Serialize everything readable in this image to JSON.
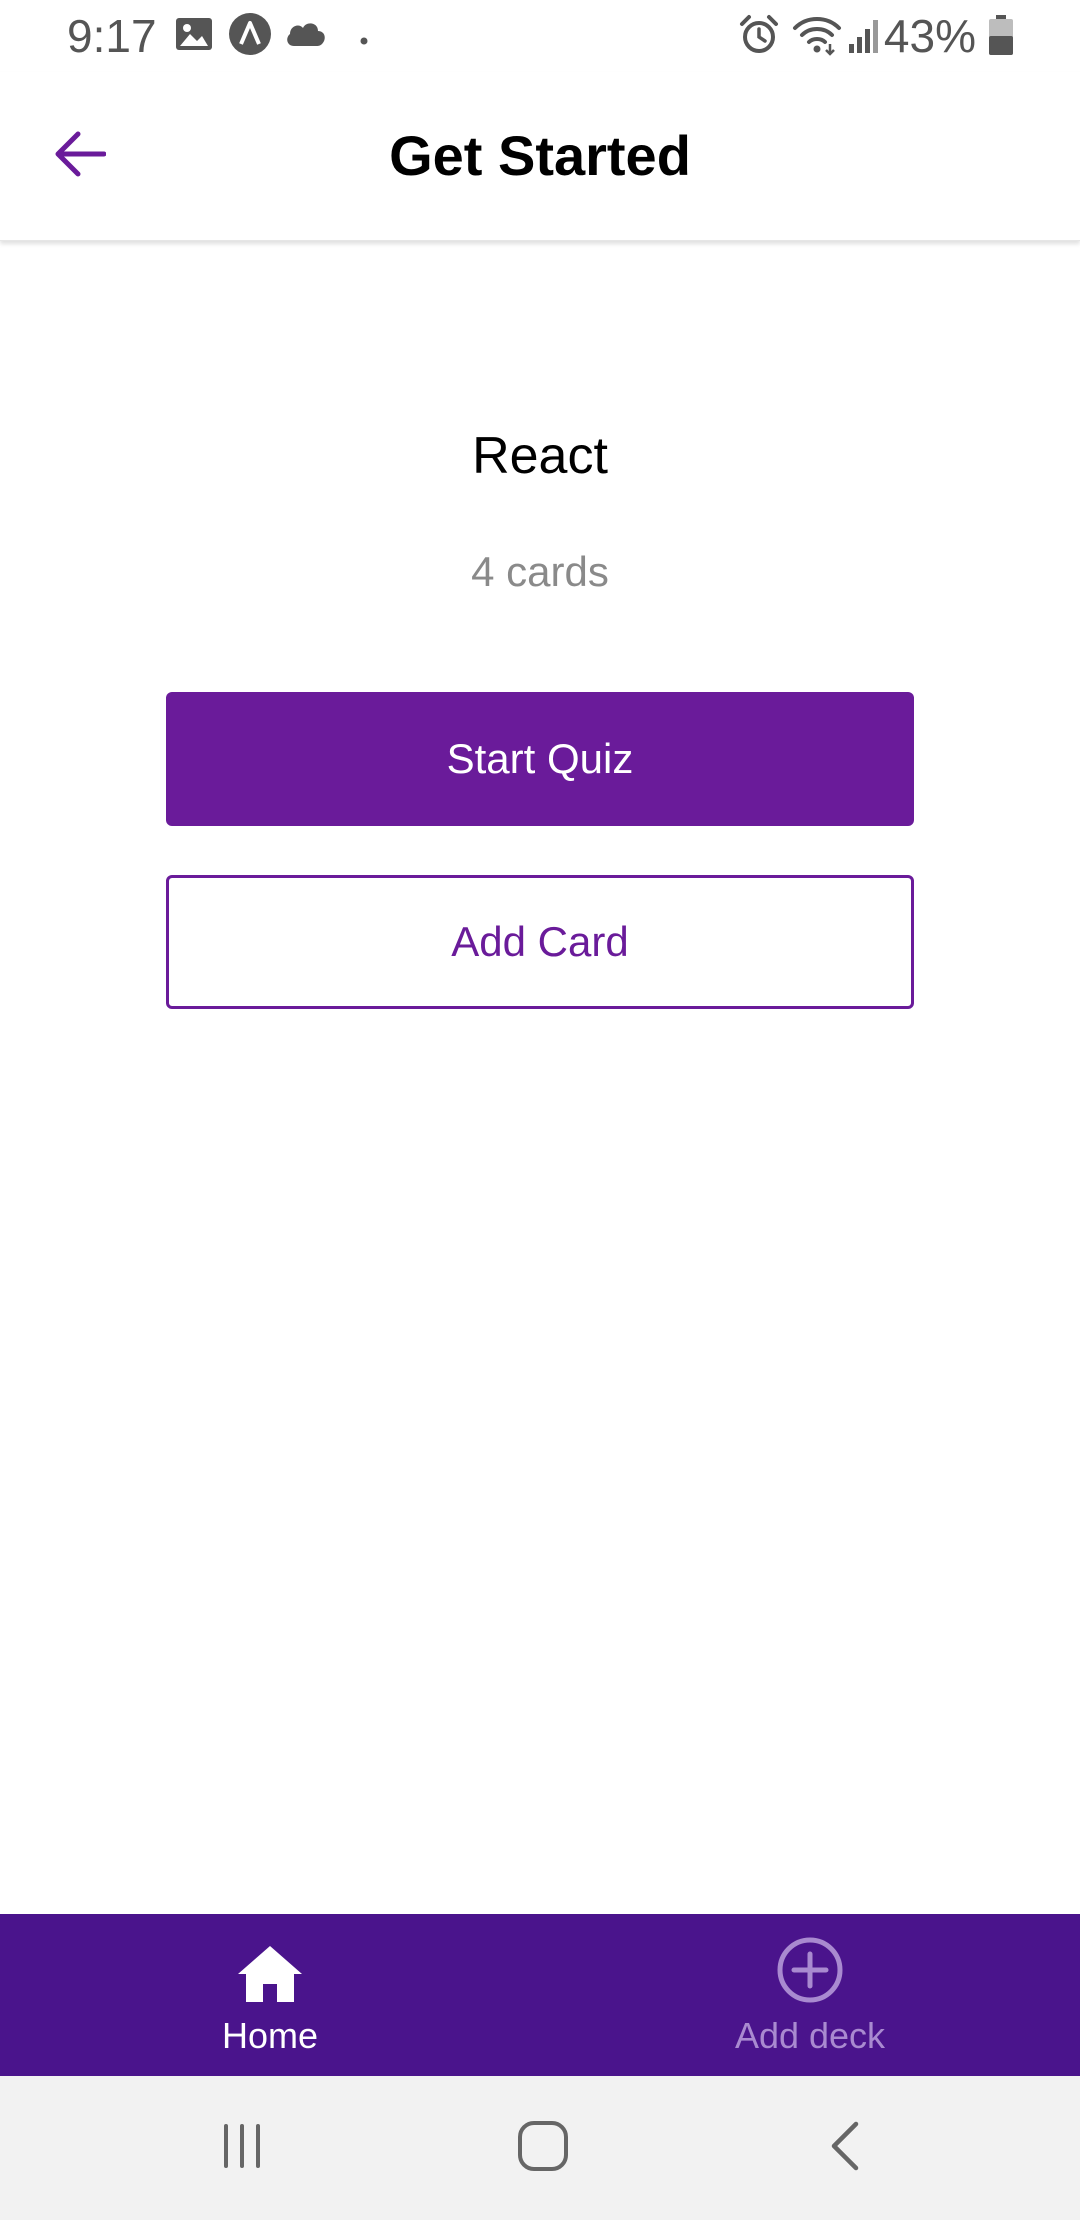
{
  "status_bar": {
    "time": "9:17",
    "battery": "43%",
    "icons": [
      "gallery-icon",
      "a-app-icon",
      "cloud-icon",
      "dot-icon",
      "alarm-icon",
      "wifi-icon",
      "signal-icon",
      "battery-icon"
    ]
  },
  "app_bar": {
    "title": "Get Started",
    "back_icon": "arrow-left-icon"
  },
  "deck": {
    "title": "React",
    "count": "4 cards"
  },
  "actions": {
    "start_quiz_label": "Start Quiz",
    "add_card_label": "Add Card"
  },
  "tab_bar": {
    "tabs": [
      {
        "label": "Home",
        "icon": "home-icon",
        "active": true
      },
      {
        "label": "Add deck",
        "icon": "plus-circle-icon",
        "active": false
      }
    ]
  },
  "system_nav": {
    "icons": [
      "recents-icon",
      "home-button-icon",
      "back-chevron-icon"
    ]
  },
  "colors": {
    "primary": "#6a1b9a",
    "tab_bar_bg": "#4a148c",
    "tab_inactive": "#a98ad0",
    "muted_text": "#8a8a8a"
  }
}
